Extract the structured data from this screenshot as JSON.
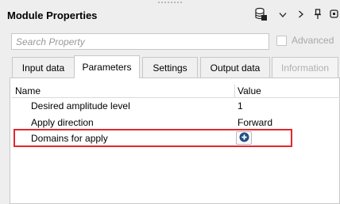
{
  "window": {
    "title": "Module Properties",
    "toolbar": {
      "database_icon": "database-icon",
      "chevron_down_icon": "chevron-down-icon",
      "chevron_right_icon": "chevron-right-icon",
      "pin_icon": "pin-icon",
      "popout_icon": "popout-icon"
    }
  },
  "search": {
    "placeholder": "Search Property",
    "value": ""
  },
  "advanced": {
    "label": "Advanced",
    "checked": false,
    "enabled": false
  },
  "tabs": [
    {
      "label": "Input data",
      "active": false,
      "enabled": true
    },
    {
      "label": "Parameters",
      "active": true,
      "enabled": true
    },
    {
      "label": "Settings",
      "active": false,
      "enabled": true
    },
    {
      "label": "Output data",
      "active": false,
      "enabled": true
    },
    {
      "label": "Information",
      "active": false,
      "enabled": false
    }
  ],
  "grid": {
    "columns": {
      "name": "Name",
      "value": "Value"
    },
    "rows": [
      {
        "name": "Desired amplitude level",
        "value": "1"
      },
      {
        "name": "Apply direction",
        "value": "Forward"
      },
      {
        "name": "Domains for apply",
        "value": "",
        "action_icon": "plus-circle-icon"
      }
    ]
  },
  "colors": {
    "highlight": "#e3262f",
    "plus_button": "#1f4e86"
  }
}
